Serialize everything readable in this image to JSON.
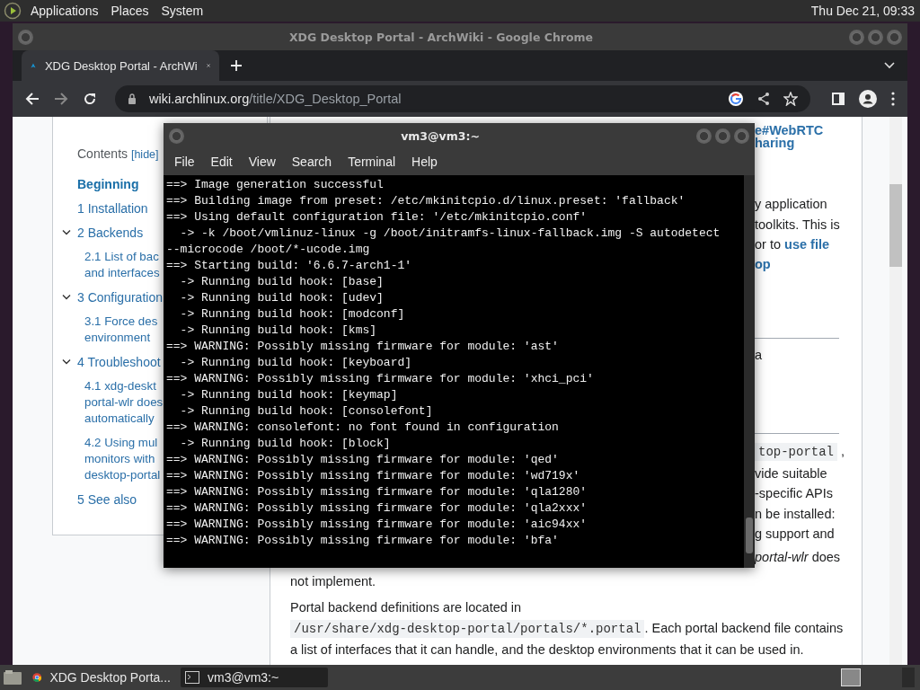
{
  "top_panel": {
    "menus": [
      "Applications",
      "Places",
      "System"
    ],
    "clock": "Thu Dec 21, 09:33"
  },
  "browser": {
    "title": "XDG Desktop Portal - ArchWiki - Google Chrome",
    "tabs": [
      {
        "label": "XDG Desktop Portal - ArchWi",
        "selected": true
      }
    ],
    "url_host": "wiki.archlinux.org",
    "url_path": "/title/XDG_Desktop_Portal",
    "toc": {
      "title": "Contents",
      "hide": "[hide]",
      "items": [
        {
          "lines": [
            "Beginning"
          ],
          "selected": true
        },
        {
          "lines": [
            "1  Installation"
          ],
          "selected": false
        },
        {
          "lines": [
            "2  Backends"
          ],
          "selected": false,
          "expanded": true,
          "children": [
            {
              "lines": [
                "2.1  List of bac",
                "and interfaces"
              ],
              "selected": false
            }
          ]
        },
        {
          "lines": [
            "3  Configuration"
          ],
          "selected": false,
          "expanded": true,
          "children": [
            {
              "lines": [
                "3.1  Force des",
                "environment"
              ],
              "selected": false
            }
          ]
        },
        {
          "lines": [
            "4  Troubleshoot"
          ],
          "selected": false,
          "expanded": true,
          "children": [
            {
              "lines": [
                "4.1  xdg-deskt",
                "portal-wlr does",
                "automatically"
              ],
              "selected": false
            },
            {
              "lines": [
                "4.2  Using mul",
                "monitors with",
                "desktop-portal"
              ],
              "selected": false
            }
          ]
        },
        {
          "lines": [
            "5  See also"
          ],
          "selected": false
        }
      ]
    },
    "right_fragments": [
      {
        "kind": "link",
        "text": "e#WebRTC"
      },
      {
        "kind": "link",
        "text": "haring"
      },
      {
        "kind": "text",
        "text": "y application"
      },
      {
        "kind": "text",
        "text": "toolkits. This is"
      },
      {
        "kind": "text",
        "text": "or to ",
        "link": "use file"
      },
      {
        "kind": "link",
        "text": "op"
      },
      {
        "kind": "rule"
      },
      {
        "kind": "text",
        "text": "a"
      },
      {
        "kind": "rule"
      },
      {
        "kind": "code",
        "text": "top-portal",
        "after": " ,"
      },
      {
        "kind": "text",
        "text": "vide suitable"
      },
      {
        "kind": "text",
        "text": "-specific APIs"
      },
      {
        "kind": "text",
        "text": "n be installed:"
      },
      {
        "kind": "text",
        "text": "g support and"
      },
      {
        "kind": "italic",
        "text": "portal-wlr",
        "after": " does"
      }
    ],
    "bottom_paragraphs": [
      {
        "text": "not implement."
      },
      {
        "text": "Portal backend definitions are located in ",
        "code": "/usr/share/xdg-desktop-portal/portals/*.portal",
        "after": ". Each portal backend file contains a list of interfaces that it can handle, and the desktop environments that it can be used in."
      }
    ]
  },
  "terminal": {
    "title": "vm3@vm3:~",
    "menus": [
      "File",
      "Edit",
      "View",
      "Search",
      "Terminal",
      "Help"
    ],
    "lines": [
      "==> Image generation successful",
      "==> Building image from preset: /etc/mkinitcpio.d/linux.preset: 'fallback'",
      "==> Using default configuration file: '/etc/mkinitcpio.conf'",
      "  -> -k /boot/vmlinuz-linux -g /boot/initramfs-linux-fallback.img -S autodetect",
      "--microcode /boot/*-ucode.img",
      "==> Starting build: '6.6.7-arch1-1'",
      "  -> Running build hook: [base]",
      "  -> Running build hook: [udev]",
      "  -> Running build hook: [modconf]",
      "  -> Running build hook: [kms]",
      "==> WARNING: Possibly missing firmware for module: 'ast'",
      "  -> Running build hook: [keyboard]",
      "==> WARNING: Possibly missing firmware for module: 'xhci_pci'",
      "  -> Running build hook: [keymap]",
      "  -> Running build hook: [consolefont]",
      "==> WARNING: consolefont: no font found in configuration",
      "  -> Running build hook: [block]",
      "==> WARNING: Possibly missing firmware for module: 'qed'",
      "==> WARNING: Possibly missing firmware for module: 'wd719x'",
      "==> WARNING: Possibly missing firmware for module: 'qla1280'",
      "==> WARNING: Possibly missing firmware for module: 'qla2xxx'",
      "==> WARNING: Possibly missing firmware for module: 'aic94xx'",
      "==> WARNING: Possibly missing firmware for module: 'bfa'"
    ]
  },
  "taskbar": {
    "items": [
      {
        "kind": "browser",
        "label": "XDG Desktop Porta...",
        "selected": false
      },
      {
        "kind": "terminal",
        "label": "vm3@vm3:~",
        "selected": true
      }
    ]
  }
}
